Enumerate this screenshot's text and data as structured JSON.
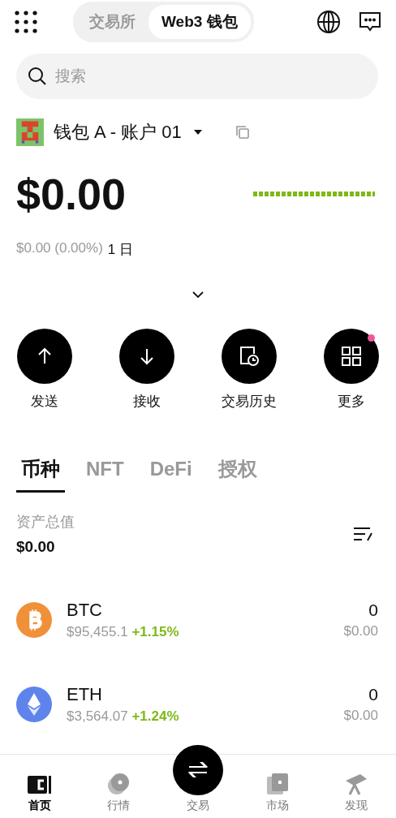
{
  "header": {
    "tabs": [
      {
        "label": "交易所",
        "selected": false
      },
      {
        "label": "Web3 钱包",
        "selected": true
      }
    ]
  },
  "search": {
    "placeholder": "搜索"
  },
  "account": {
    "name": "钱包 A - 账户 01"
  },
  "balance": {
    "amount": "$0.00",
    "change": "$0.00 (0.00%)",
    "period": "1 日"
  },
  "actions": [
    {
      "label": "发送",
      "badge": false
    },
    {
      "label": "接收",
      "badge": false
    },
    {
      "label": "交易历史",
      "badge": false
    },
    {
      "label": "更多",
      "badge": true
    }
  ],
  "asset_tabs": [
    {
      "label": "币种",
      "selected": true
    },
    {
      "label": "NFT",
      "selected": false
    },
    {
      "label": "DeFi",
      "selected": false
    },
    {
      "label": "授权",
      "selected": false
    }
  ],
  "total": {
    "label": "资产总值",
    "value": "$0.00"
  },
  "coins": [
    {
      "symbol": "BTC",
      "price": "$95,455.1",
      "change": "+1.15%",
      "amount": "0",
      "value": "$0.00"
    },
    {
      "symbol": "ETH",
      "price": "$3,564.07",
      "change": "+1.24%",
      "amount": "0",
      "value": "$0.00"
    }
  ],
  "nav": [
    {
      "label": "首页",
      "kind": "tab",
      "selected": true
    },
    {
      "label": "行情",
      "kind": "tab",
      "selected": false
    },
    {
      "label": "交易",
      "kind": "action"
    },
    {
      "label": "市场",
      "kind": "tab",
      "selected": false
    },
    {
      "label": "发现",
      "kind": "tab",
      "selected": false
    }
  ]
}
